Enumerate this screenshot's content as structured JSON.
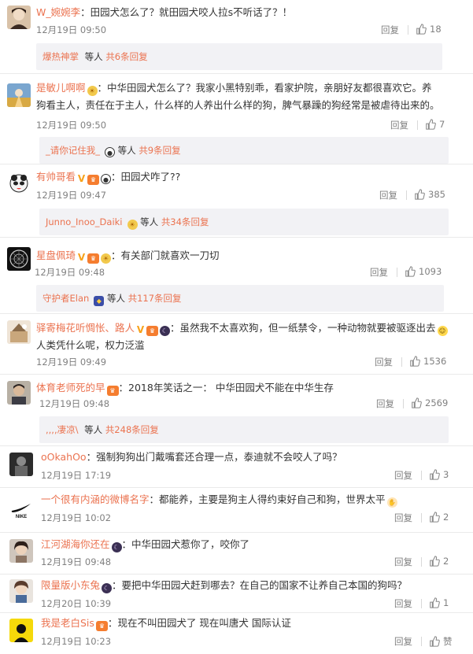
{
  "comments": [
    {
      "user": "W_婉婉李",
      "text": "田园犬怎么了？就田园犬咬人拉s不听话了？！",
      "time": "12月19日 09:50",
      "reply": "回复",
      "likes": "18",
      "sub": {
        "user": "爆热神掌",
        "middle": "等人",
        "more": "共6条回复"
      }
    },
    {
      "user": "是敏儿啊啊",
      "text": "中华田园犬怎么了？我家小黑特别乖，看家护院，亲朋好友都很喜欢它。养狗看主人，责任在于主人，什么样的人养出什么样的狗，脾气暴躁的狗经常是被虐待出来的。",
      "time": "12月19日 09:50",
      "reply": "回复",
      "likes": "7",
      "sub": {
        "user": "_请你记住我_",
        "middle": "等人",
        "more": "共9条回复"
      }
    },
    {
      "user": "有帅哥看",
      "text": "田园犬咋了??",
      "time": "12月19日 09:47",
      "reply": "回复",
      "likes": "385",
      "sub": {
        "user": "Junno_Inoo_Daiki",
        "middle": "等人",
        "more": "共34条回复"
      }
    },
    {
      "user": "星盘佩琦",
      "text": "有关部门就喜欢一刀切",
      "time": "12月19日 09:48",
      "reply": "回复",
      "likes": "1093",
      "sub": {
        "user": "守护者Elan",
        "middle": "等人",
        "more": "共117条回复"
      }
    },
    {
      "user": "驿寄梅花听惆怅、路人",
      "text": "虽然我不太喜欢狗，但一纸禁令，一种动物就要被驱逐出去",
      "text2": "人类凭什么呢，权力泛滥",
      "time": "12月19日 09:49",
      "reply": "回复",
      "likes": "1536"
    },
    {
      "user": "体育老师死的早",
      "text": "2018年笑话之一： 中华田园犬不能在中华生存",
      "time": "12月19日 09:48",
      "reply": "回复",
      "likes": "2569",
      "sub": {
        "user": ",,,,凄凉\\",
        "middle": "等人",
        "more": "共248条回复"
      }
    },
    {
      "user": "oOkahOo",
      "text": "强制狗狗出门戴嘴套还合理一点，泰迪就不会咬人了吗？",
      "time": "12月19日 17:19",
      "reply": "回复",
      "likes": "3"
    },
    {
      "user": "一个很有内涵的微博名字",
      "text": "都能养，主要是狗主人得约束好自己和狗，世界太平",
      "time": "12月19日 10:02",
      "reply": "回复",
      "likes": "2"
    },
    {
      "user": "江河湖海你还在",
      "text": "中华田园犬惹你了，咬你了",
      "time": "12月19日 09:48",
      "reply": "回复",
      "likes": "2"
    },
    {
      "user": "限量版小东兔",
      "text": "要把中华田园犬赶到哪去？在自己的国家不让养自己本国的狗吗？",
      "time": "12月20日 10:39",
      "reply": "回复",
      "likes": "1"
    },
    {
      "user": "我是老白Sis",
      "text": "现在不叫田园犬了 现在叫唐犬 国际认证",
      "time": "12月19日 10:23",
      "reply": "回复",
      "likes": "赞"
    }
  ],
  "colors": {
    "username": "#eb7350",
    "meta": "#808080",
    "subbox_bg": "#f2f2f5"
  },
  "icons": {
    "like": "thumbs-up-icon"
  }
}
